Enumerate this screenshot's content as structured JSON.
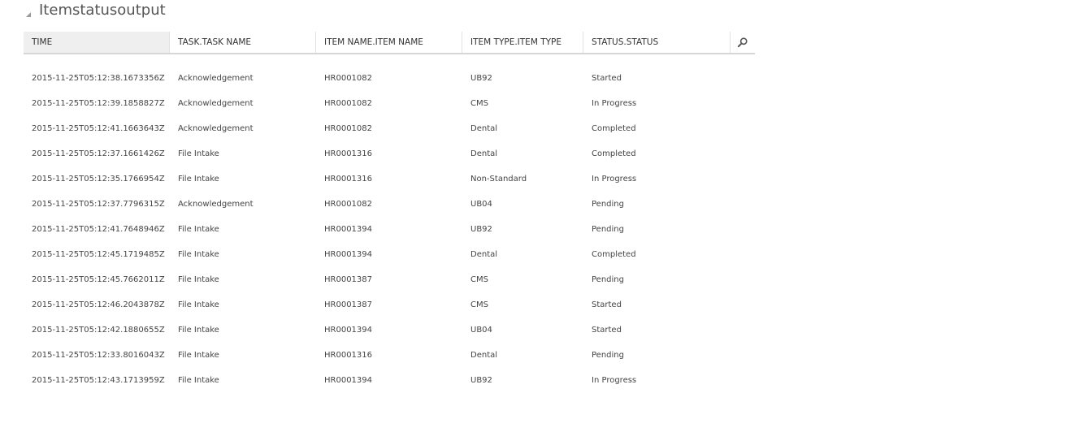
{
  "section": {
    "title": "Itemstatusoutput",
    "collapse_icon": "triangle-collapse-icon"
  },
  "columns": [
    {
      "key": "time",
      "label": "TIME"
    },
    {
      "key": "task",
      "label": "TASK.TASK NAME"
    },
    {
      "key": "item",
      "label": "ITEM NAME.ITEM NAME"
    },
    {
      "key": "type",
      "label": "ITEM TYPE.ITEM TYPE"
    },
    {
      "key": "status",
      "label": "STATUS.STATUS"
    }
  ],
  "search_icon": "magnifier-search-icon",
  "rows": [
    {
      "time": "2015-11-25T05:12:38.1673356Z",
      "task": "Acknowledgement",
      "item": "HR0001082",
      "type": "UB92",
      "status": "Started"
    },
    {
      "time": "2015-11-25T05:12:39.1858827Z",
      "task": "Acknowledgement",
      "item": "HR0001082",
      "type": "CMS",
      "status": "In Progress"
    },
    {
      "time": "2015-11-25T05:12:41.1663643Z",
      "task": "Acknowledgement",
      "item": "HR0001082",
      "type": "Dental",
      "status": "Completed"
    },
    {
      "time": "2015-11-25T05:12:37.1661426Z",
      "task": "File Intake",
      "item": "HR0001316",
      "type": "Dental",
      "status": "Completed"
    },
    {
      "time": "2015-11-25T05:12:35.1766954Z",
      "task": "File Intake",
      "item": "HR0001316",
      "type": "Non-Standard",
      "status": "In Progress"
    },
    {
      "time": "2015-11-25T05:12:37.7796315Z",
      "task": "Acknowledgement",
      "item": "HR0001082",
      "type": "UB04",
      "status": "Pending"
    },
    {
      "time": "2015-11-25T05:12:41.7648946Z",
      "task": "File Intake",
      "item": "HR0001394",
      "type": "UB92",
      "status": "Pending"
    },
    {
      "time": "2015-11-25T05:12:45.1719485Z",
      "task": "File Intake",
      "item": "HR0001394",
      "type": "Dental",
      "status": "Completed"
    },
    {
      "time": "2015-11-25T05:12:45.7662011Z",
      "task": "File Intake",
      "item": "HR0001387",
      "type": "CMS",
      "status": "Pending"
    },
    {
      "time": "2015-11-25T05:12:46.2043878Z",
      "task": "File Intake",
      "item": "HR0001387",
      "type": "CMS",
      "status": "Started"
    },
    {
      "time": "2015-11-25T05:12:42.1880655Z",
      "task": "File Intake",
      "item": "HR0001394",
      "type": "UB04",
      "status": "Started"
    },
    {
      "time": "2015-11-25T05:12:33.8016043Z",
      "task": "File Intake",
      "item": "HR0001316",
      "type": "Dental",
      "status": "Pending"
    },
    {
      "time": "2015-11-25T05:12:43.1713959Z",
      "task": "File Intake",
      "item": "HR0001394",
      "type": "UB92",
      "status": "In Progress"
    }
  ]
}
